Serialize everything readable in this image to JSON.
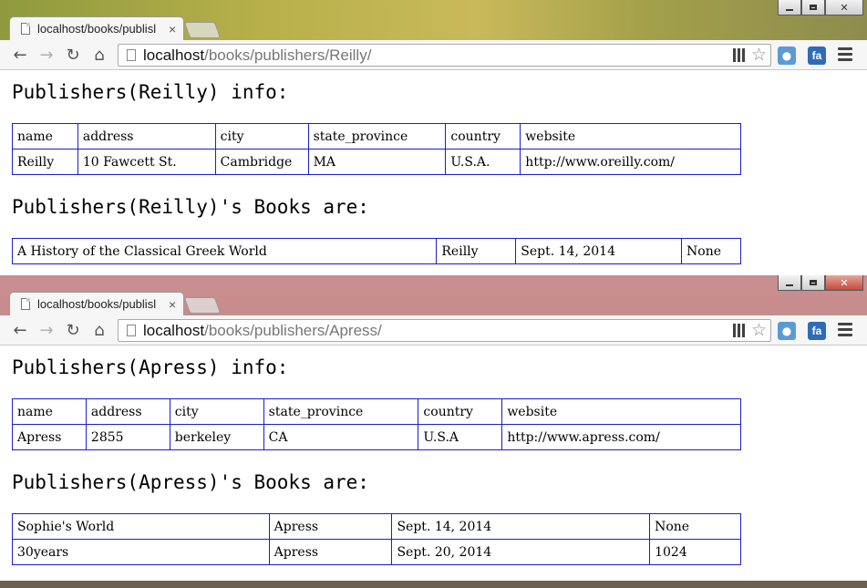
{
  "windows": [
    {
      "tab_title": "localhost/books/publisl",
      "url_host": "localhost",
      "url_path": "/books/publishers/Reilly/",
      "info_heading": "Publishers(Reilly) info:",
      "info_headers": [
        "name",
        "address",
        "city",
        "state_province",
        "country",
        "website"
      ],
      "info_row": [
        "Reilly",
        "10 Fawcett St.",
        "Cambridge",
        "MA",
        "U.S.A.",
        "http://www.oreilly.com/"
      ],
      "books_heading": "Publishers(Reilly)'s Books are:",
      "books": [
        [
          "A History of the Classical Greek World",
          "Reilly",
          "Sept. 14, 2014",
          "None"
        ]
      ]
    },
    {
      "tab_title": "localhost/books/publisl",
      "url_host": "localhost",
      "url_path": "/books/publishers/Apress/",
      "info_heading": "Publishers(Apress) info:",
      "info_headers": [
        "name",
        "address",
        "city",
        "state_province",
        "country",
        "website"
      ],
      "info_row": [
        "Apress",
        "2855",
        "berkeley",
        "CA",
        "U.S.A",
        "http://www.apress.com/"
      ],
      "books_heading": "Publishers(Apress)'s Books are:",
      "books": [
        [
          "Sophie's World",
          "Apress",
          "Sept. 14, 2014",
          "None"
        ],
        [
          "30years",
          "Apress",
          "Sept. 20, 2014",
          "1024"
        ]
      ]
    }
  ],
  "icons": {
    "back": "arrow-left-icon",
    "forward": "arrow-right-icon",
    "reload": "reload-icon",
    "home": "home-icon",
    "qr": "qr-code-icon",
    "bookmark": "star-icon",
    "screenshot": "camera-icon",
    "extension": "fa-extension-icon",
    "menu": "hamburger-menu-icon"
  },
  "colors": {
    "table_border": "#1c1cd0"
  }
}
